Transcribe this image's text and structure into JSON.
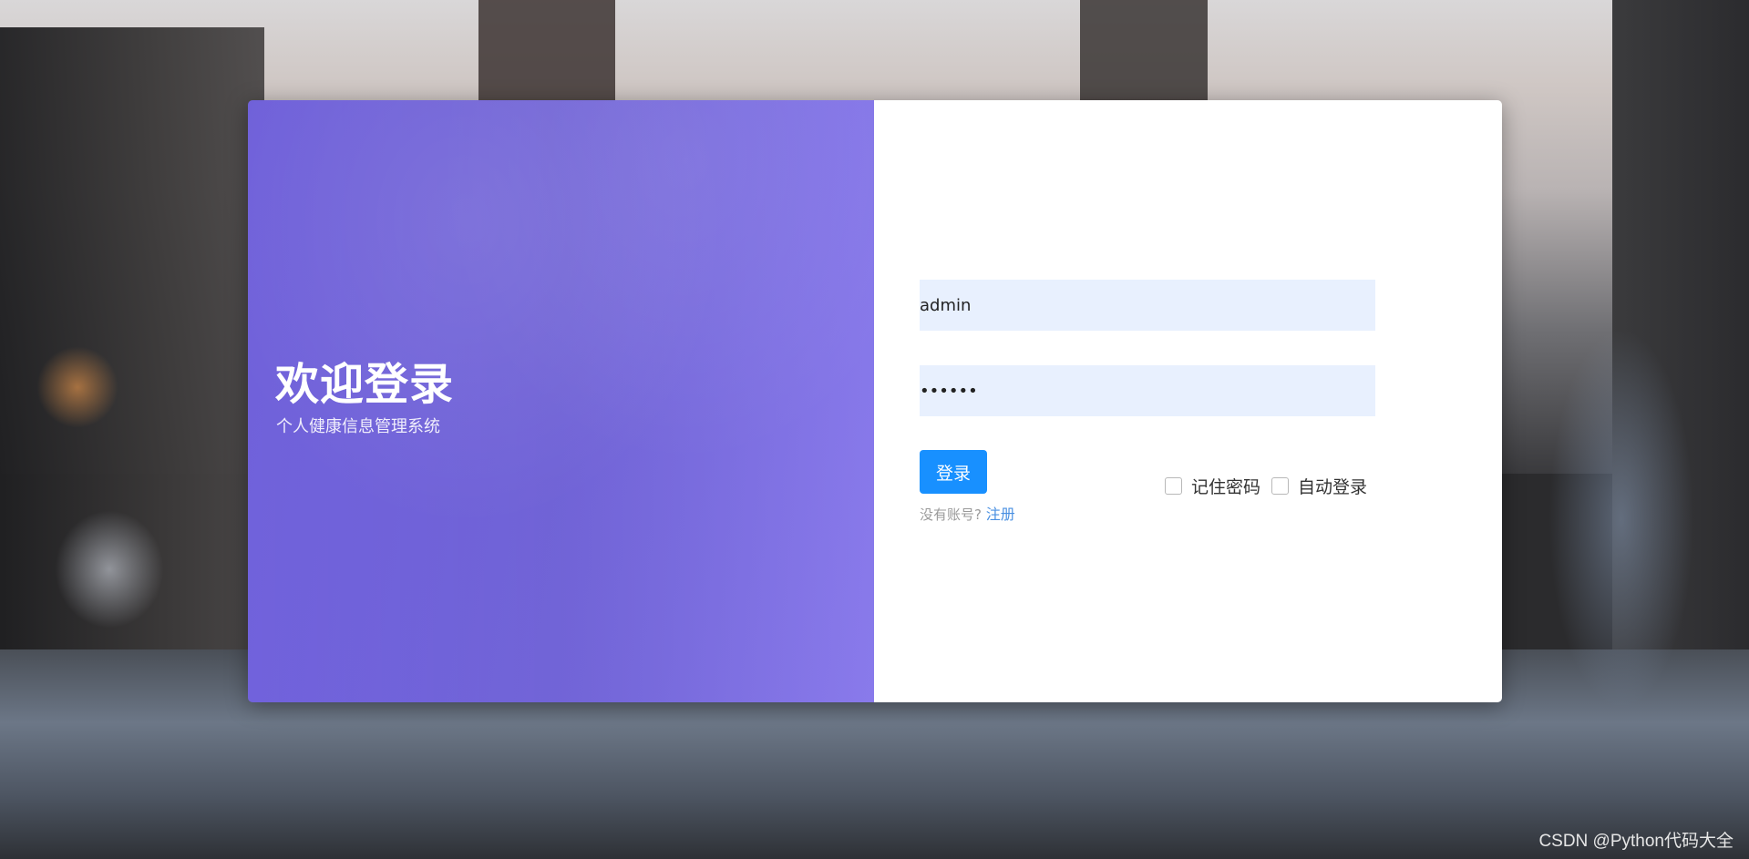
{
  "login_hero": {
    "title": "欢迎登录",
    "subtitle": "个人健康信息管理系统"
  },
  "login_form": {
    "username_value": "admin",
    "password_value": "••••••",
    "login_button_label": "登录",
    "no_account_text": "没有账号?",
    "register_link_label": "注册",
    "remember_password_label": "记住密码",
    "auto_login_label": "自动登录"
  },
  "watermark": "CSDN @Python代码大全",
  "colors": {
    "left_panel": "#7466e0",
    "primary_button": "#1890ff",
    "input_fill": "#e8f0fe",
    "link": "#4a90e2"
  }
}
